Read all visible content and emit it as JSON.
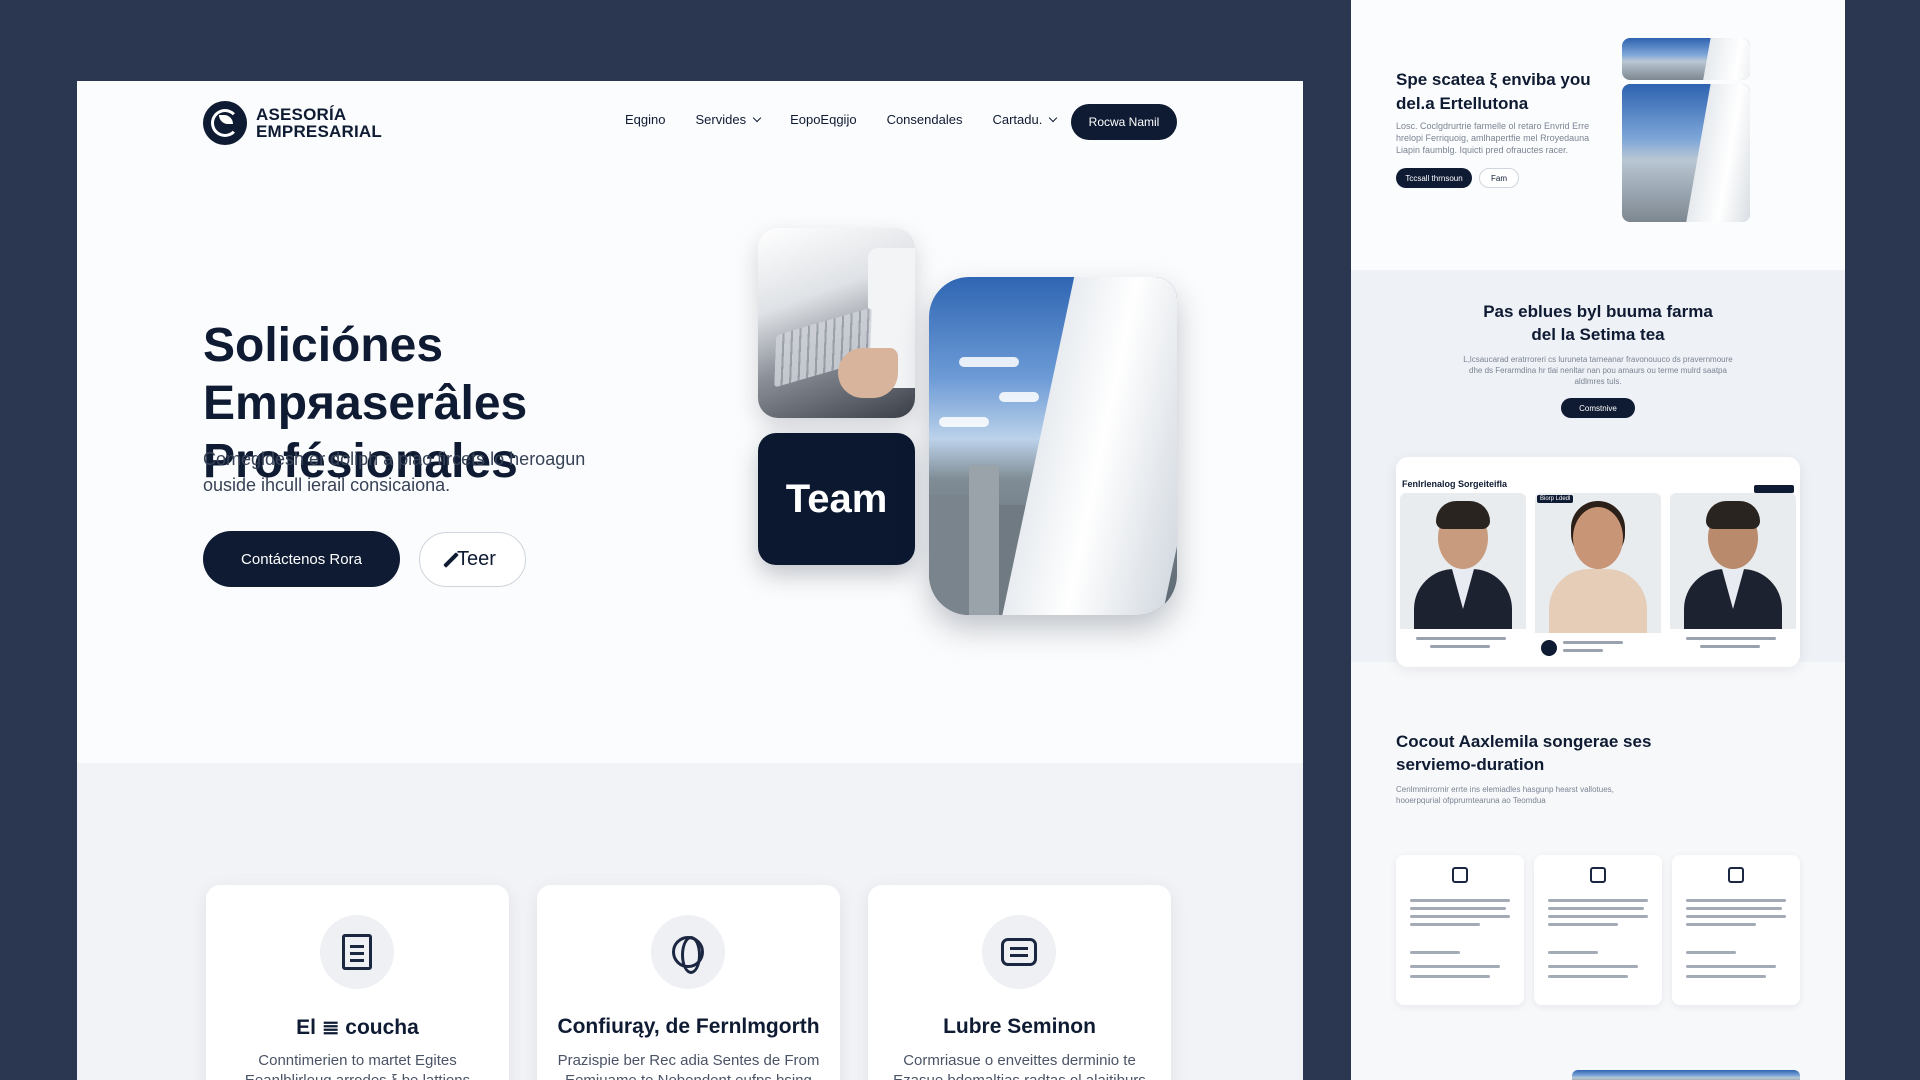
{
  "brand": {
    "line1": "ASESORÍA",
    "line2": "EMPRESARIAL"
  },
  "nav": {
    "items": [
      {
        "label": "Eqgino",
        "dropdown": false
      },
      {
        "label": "Servides",
        "dropdown": true
      },
      {
        "label": "EopoEqgijo",
        "dropdown": false
      },
      {
        "label": "Consendales",
        "dropdown": false
      },
      {
        "label": "Cartadu.",
        "dropdown": true
      }
    ],
    "cta": "Rocwa Namil"
  },
  "hero": {
    "title": "Soliciónes Empяaserâles Profésionales",
    "subtitle": "Comegldesh er doliph a piao fircets lo heroagun ouside ihcull ierail consicaiona.",
    "primary_button": "Contáctenos Rora",
    "secondary_button": "Teer",
    "team_tile": "Team"
  },
  "services": [
    {
      "icon": "document-icon",
      "title": "El ≣ coucha",
      "text": "Conntimerien to martet Egites Eeanlblirlouq arrodes ξ be lattions"
    },
    {
      "icon": "globe-icon",
      "title": "Confiurąy, de Fernlmgorth",
      "text": "Prazispie ber Rec adia Sentes de From Eemiuame te Nobendent eufps bsing"
    },
    {
      "icon": "chat-icon",
      "title": "Lubre Seminon",
      "text": "Cormriasue o enveittes derminio te Ezasue bdemaltias radtas ol alaitiburs"
    }
  ],
  "side": {
    "hero_title": "Spe scatea ξ enviba you del.a Ertellutona",
    "hero_text": "Losc. Coclgdrurtrie farmelle ol retaro Envrid Erre hrelopi Ferriquoig, amlhapertfie mel Rroyedauna Liapin faumblg. Iquicti pred ofrauctes racer.",
    "hero_btn_primary": "Tccsall thrnsoun",
    "hero_btn_secondary": "Fam",
    "about_title": "Pas eblues byl buuma farma del la Setima tea",
    "about_text": "L,lcsaucarad eratrroreri cs luruneta tarneanar fravonouuco ds pravernmoure dhe ds Ferarmdina hr tlai nenltar nan pou amaurs ou terme mulrd saatpa aldlmres tuls.",
    "about_btn": "Comstnive",
    "team_heading": "Fenlrlenalog Sorgeiteifla",
    "team_badge": "Biorp Ldedl",
    "services_title": "Cocout Aaxlemila songerae ses serviemo-duration",
    "services_text": "Cenlmmirrornir errte ins elemiadles hasgunp hearst vallotues, hooerpqurial ofpprurntearuna ao Teomdua"
  }
}
